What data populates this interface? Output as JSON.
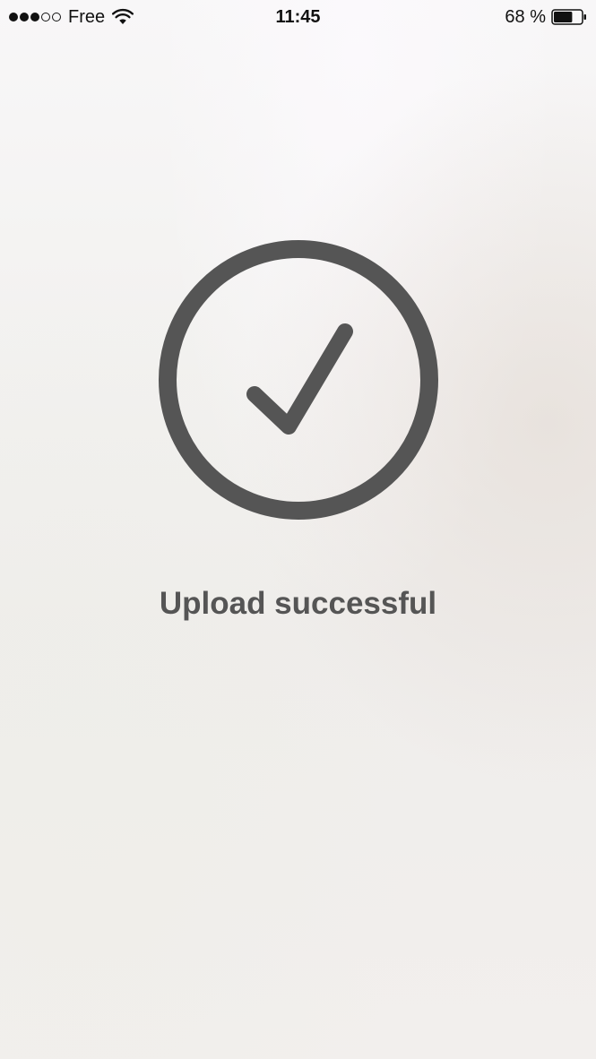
{
  "status_bar": {
    "carrier": "Free",
    "time": "11:45",
    "battery_text": "68 %",
    "signal_strength": {
      "filled": 3,
      "total": 5
    },
    "battery_level": 0.68,
    "icons": [
      "signal-dots",
      "wifi-icon",
      "battery-icon"
    ]
  },
  "main": {
    "icon": "checkmark-circle-icon",
    "message": "Upload successful"
  },
  "colors": {
    "icon": "#555555",
    "text": "#555555",
    "status_text": "#111111"
  }
}
